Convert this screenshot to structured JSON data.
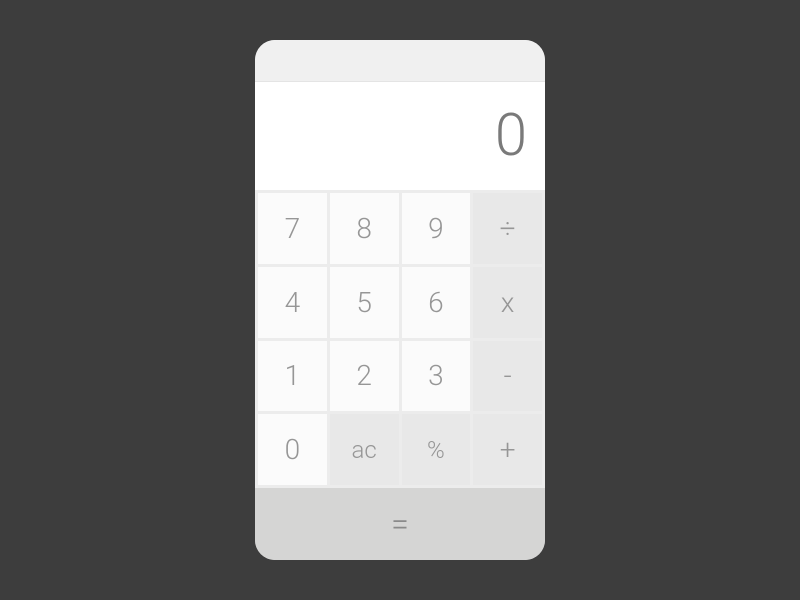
{
  "display": {
    "value": "0"
  },
  "keys": {
    "seven": "7",
    "eight": "8",
    "nine": "9",
    "divide": "÷",
    "four": "4",
    "five": "5",
    "six": "6",
    "multiply": "x",
    "one": "1",
    "two": "2",
    "three": "3",
    "subtract": "-",
    "zero": "0",
    "clear": "ac",
    "percent": "%",
    "add": "+",
    "equals": "="
  }
}
